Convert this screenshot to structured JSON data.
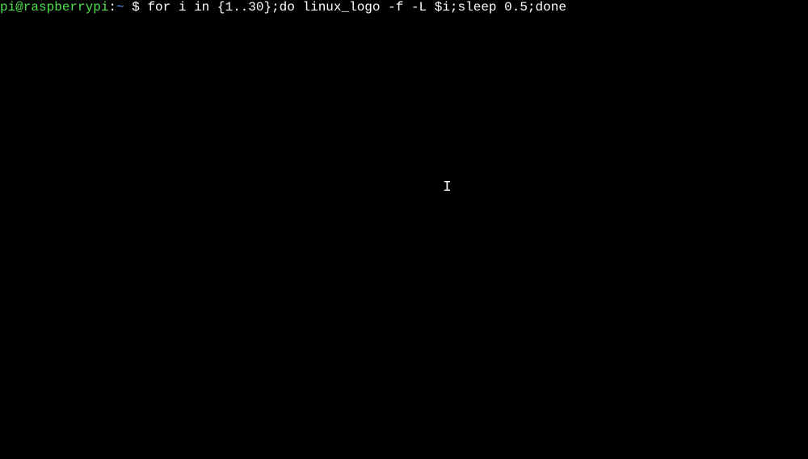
{
  "prompt": {
    "user_host": "pi@raspberrypi",
    "separator": ":",
    "path": "~",
    "symbol": " $ ",
    "command": "for i in {1..30};do linux_logo -f -L $i;sleep 0.5;done"
  },
  "cursor": {
    "glyph": "I"
  }
}
